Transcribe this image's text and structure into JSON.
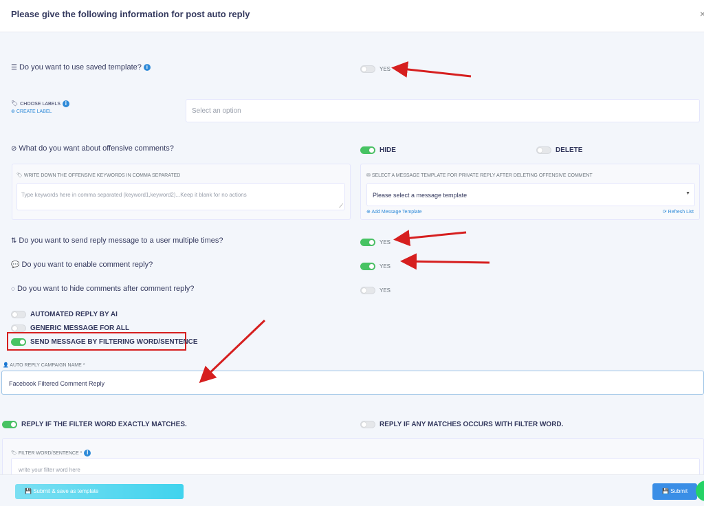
{
  "header": {
    "title": "Please give the following information for post auto reply",
    "close": "×"
  },
  "saved_template": {
    "question": "Do you want to use saved template?",
    "info": "i",
    "toggle_label": "YES",
    "on": false
  },
  "labels": {
    "title": "CHOOSE LABELS",
    "info": "i",
    "create": "CREATE LABEL",
    "placeholder": "Select an option"
  },
  "offensive": {
    "question": "What do you want about offensive comments?",
    "hide_label": "HIDE",
    "delete_label": "DELETE",
    "keywords_label": "WRITE DOWN THE OFFENSIVE KEYWORDS IN COMMA SEPARATED",
    "keywords_placeholder": "Type keywords here in comma separated (keyword1,keyword2)...Keep it blank for no actions",
    "template_label": "SELECT A MESSAGE TEMPLATE FOR PRIVATE REPLY AFTER DELETING OFFENSIVE COMMENT",
    "template_select": "Please select a message template",
    "add_template": "Add Message Template",
    "refresh": "Refresh List"
  },
  "multi_reply": {
    "question": "Do you want to send reply message to a user multiple times?",
    "toggle_label": "YES",
    "on": true
  },
  "comment_reply": {
    "question": "Do you want to enable comment reply?",
    "toggle_label": "YES",
    "on": true
  },
  "hide_comments": {
    "question": "Do you want to hide comments after comment reply?",
    "toggle_label": "YES",
    "on": false
  },
  "modes": [
    {
      "label": "AUTOMATED REPLY BY AI",
      "on": false
    },
    {
      "label": "GENERIC MESSAGE FOR ALL",
      "on": false
    },
    {
      "label": "SEND MESSAGE BY FILTERING WORD/SENTENCE",
      "on": true
    }
  ],
  "campaign": {
    "label": "AUTO REPLY CAMPAIGN NAME",
    "required": "*",
    "value": "Facebook Filtered Comment Reply"
  },
  "match": {
    "exact_label": "REPLY IF THE FILTER WORD EXACTLY MATCHES.",
    "any_label": "REPLY IF ANY MATCHES OCCURS WITH FILTER WORD."
  },
  "filter": {
    "label": "FILTER WORD/SENTENCE",
    "required": "*",
    "info": "i",
    "placeholder": "write your filter word here"
  },
  "footer": {
    "save_template": "Submit & save as template",
    "submit": "Submit"
  },
  "colors": {
    "accent": "#47c363",
    "primary": "#3a8ee6",
    "highlight": "#d61f1f"
  }
}
